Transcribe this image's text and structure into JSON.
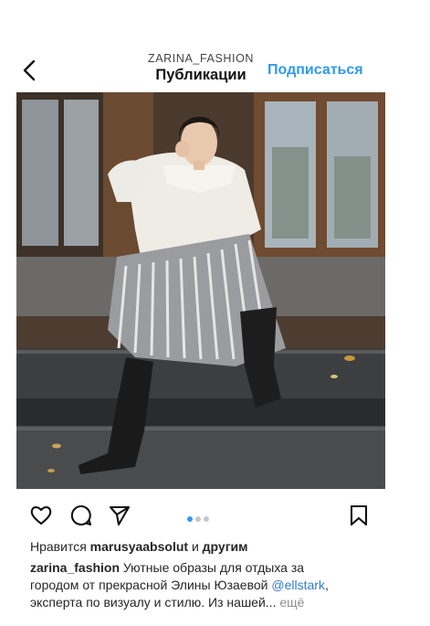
{
  "header": {
    "account": "ZARINA_FASHION",
    "title": "Публикации",
    "follow_label": "Подписаться"
  },
  "post": {
    "carousel": {
      "total": 3,
      "active": 1
    },
    "likes": {
      "prefix": "Нравится",
      "user": "marusyaabsolut",
      "joiner": "и",
      "others": "другим"
    },
    "caption": {
      "author": "zarina_fashion",
      "line1": "Уютные образы для отдыха за",
      "line2_before": "городом от прекрасной Элины Юзаевой",
      "mention": "@ellstark",
      "line2_after": ",",
      "line3": "эксперта по визуалу и стилю. Из нашей...",
      "more": "ещё"
    }
  },
  "icons": [
    "back-icon",
    "heart-icon",
    "comment-icon",
    "share-icon",
    "bookmark-icon"
  ],
  "colors": {
    "accent": "#2f9af0",
    "mention": "#2f7bd0",
    "text": "#262626",
    "muted": "#8e8e8e"
  }
}
